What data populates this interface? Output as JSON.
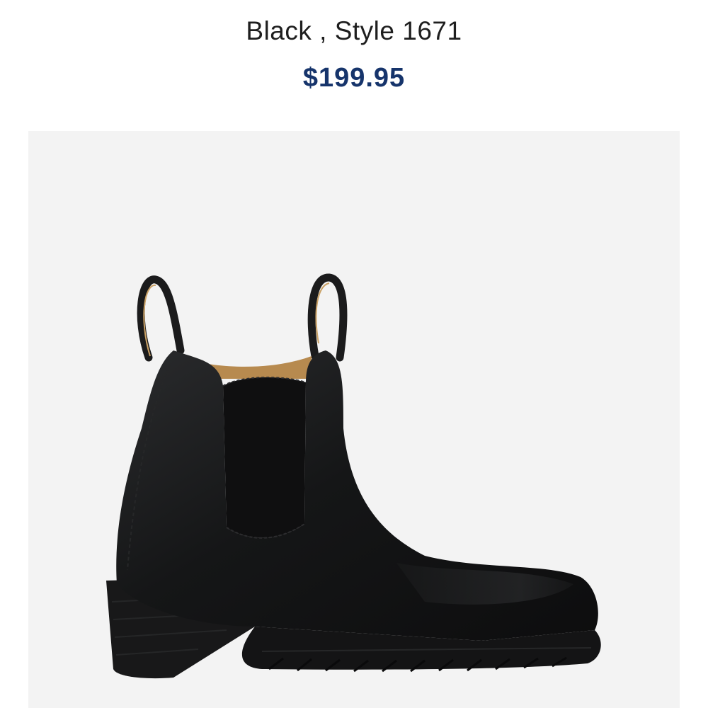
{
  "product": {
    "title": "Black , Style 1671",
    "price": "$199.95",
    "colors": {
      "price": "#16346b",
      "image_background": "#f3f3f3",
      "boot": "#151516",
      "pull_tab_lining": "#c9a064"
    }
  }
}
